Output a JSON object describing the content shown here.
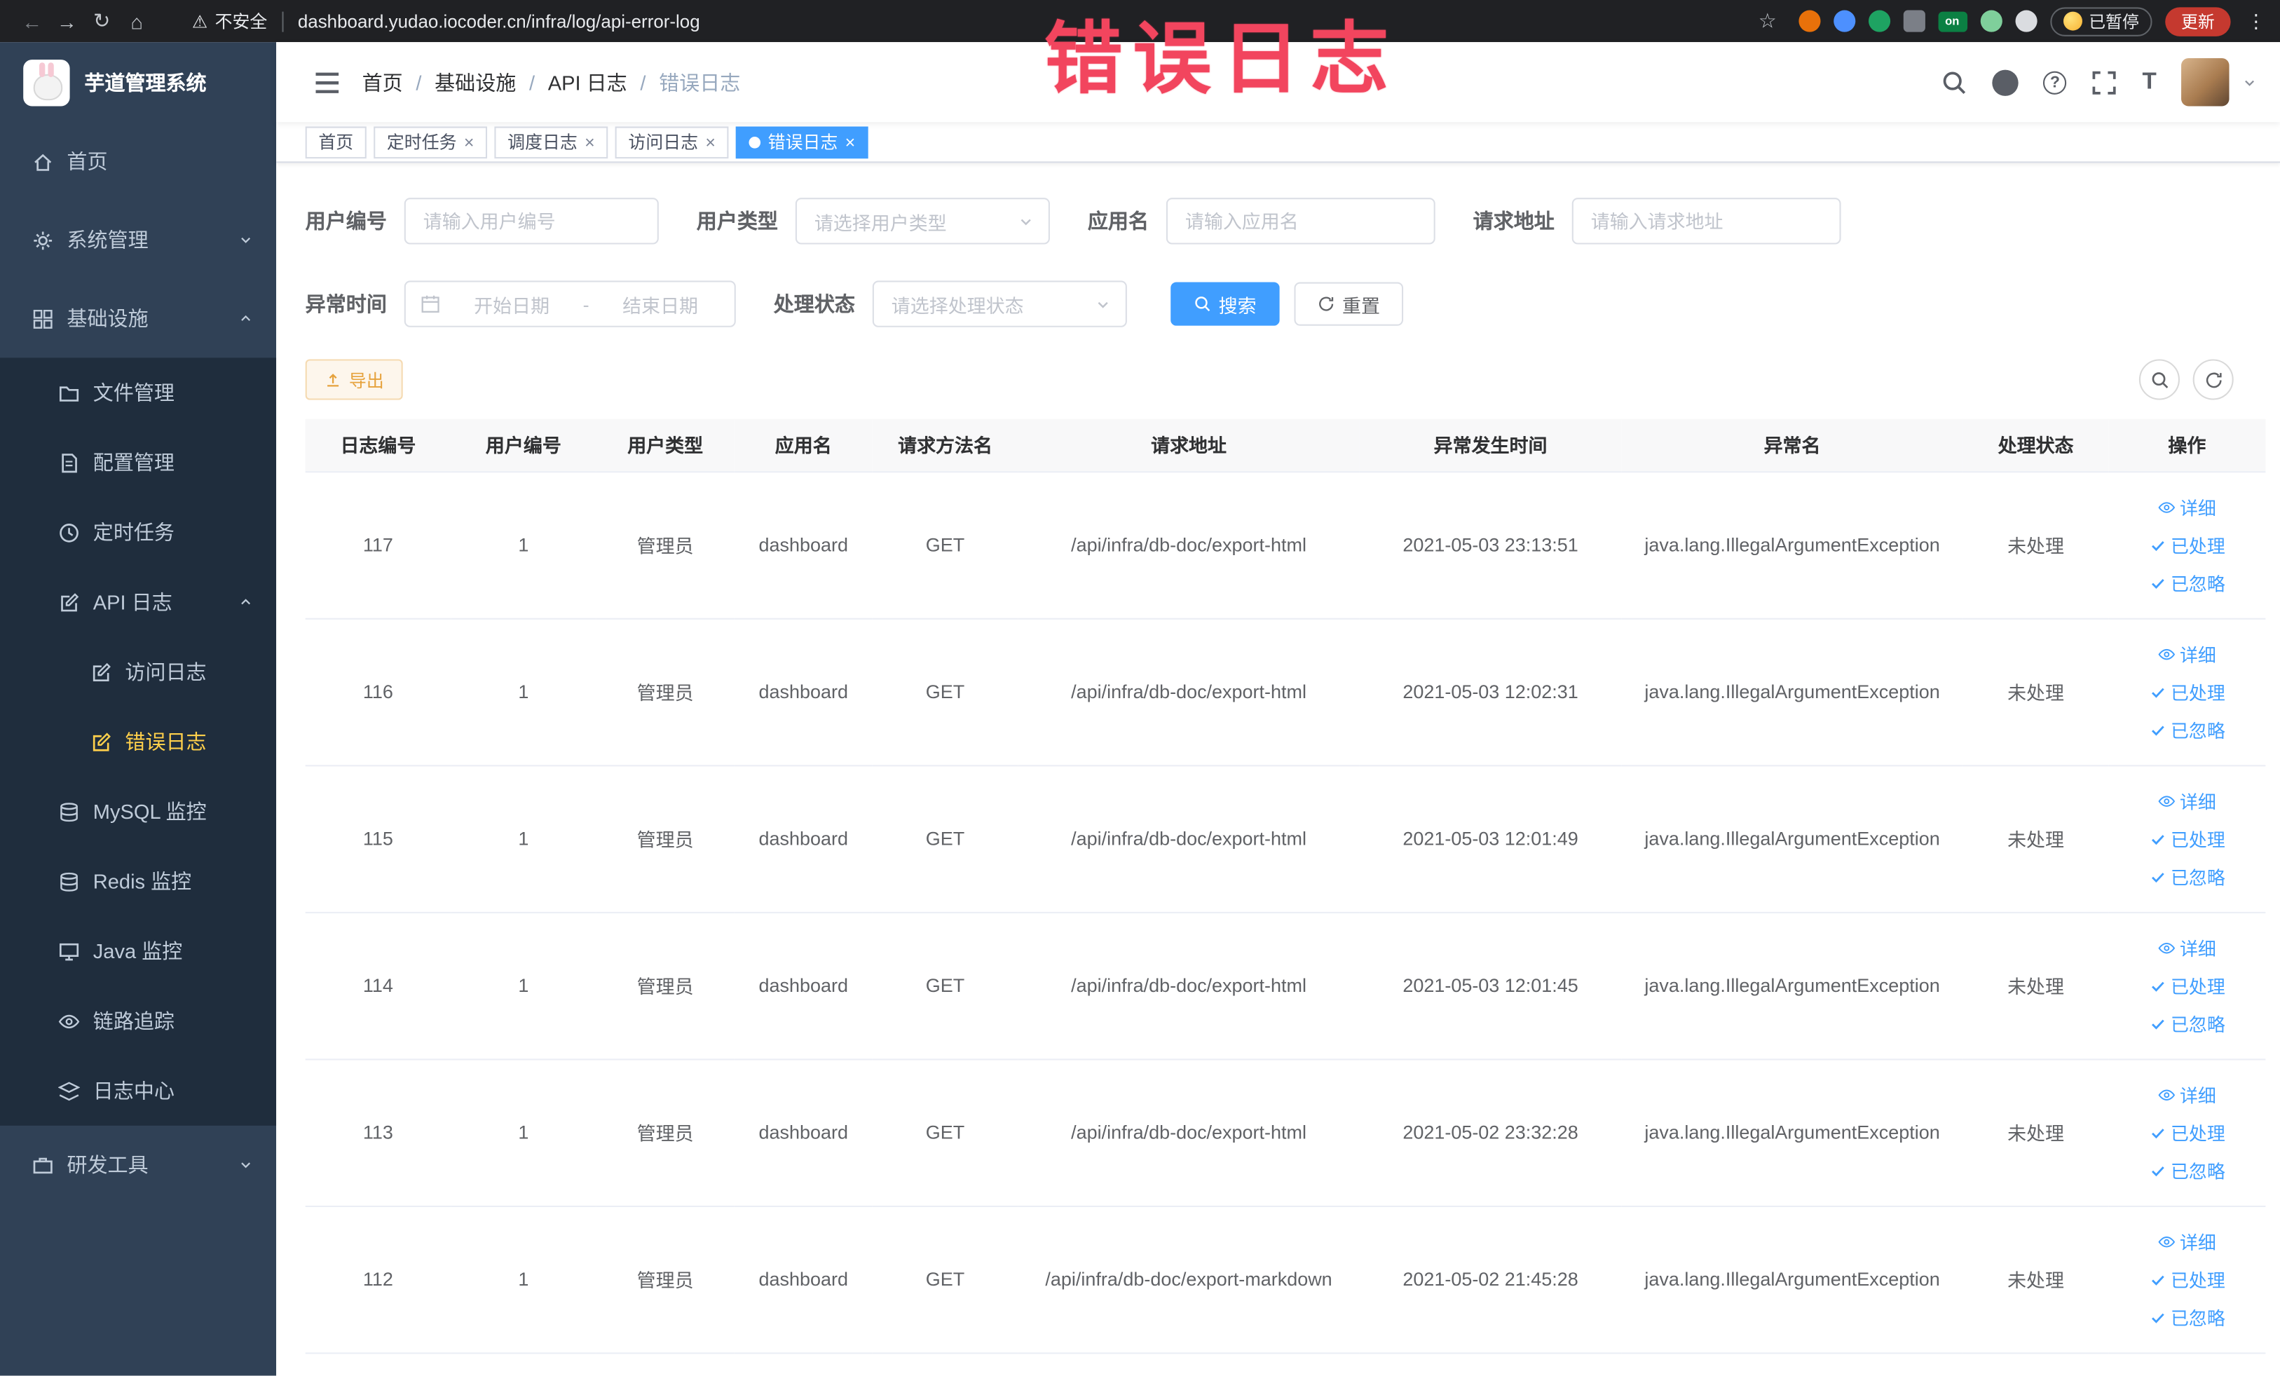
{
  "browser": {
    "security_label": "不安全",
    "url": "dashboard.yudao.iocoder.cn/infra/log/api-error-log",
    "extension_on_badge": "on",
    "paused_button": "已暂停",
    "update_button": "更新"
  },
  "icons": {
    "back": "←",
    "forward": "→",
    "reload": "↻",
    "home": "⌂",
    "star": "☆",
    "warning": "⚠",
    "kebab": "⋮",
    "close": "×",
    "question": "?",
    "font_size": "T"
  },
  "watermark": "错误日志",
  "sidebar": {
    "logo_title": "芋道管理系统",
    "home": "首页",
    "system_mgmt": "系统管理",
    "infrastructure": "基础设施",
    "file_mgmt": "文件管理",
    "config_mgmt": "配置管理",
    "scheduled_tasks": "定时任务",
    "api_log": "API 日志",
    "access_log": "访问日志",
    "error_log": "错误日志",
    "mysql_monitor": "MySQL 监控",
    "redis_monitor": "Redis 监控",
    "java_monitor": "Java 监控",
    "trace": "链路追踪",
    "log_center": "日志中心",
    "dev_tools": "研发工具"
  },
  "breadcrumb": {
    "separator": "/",
    "items": [
      "首页",
      "基础设施",
      "API 日志",
      "错误日志"
    ]
  },
  "tabs": [
    "首页",
    "定时任务",
    "调度日志",
    "访问日志",
    "错误日志"
  ],
  "filters": {
    "user_id_label": "用户编号",
    "user_id_placeholder": "请输入用户编号",
    "user_type_label": "用户类型",
    "user_type_placeholder": "请选择用户类型",
    "app_name_label": "应用名",
    "app_name_placeholder": "请输入应用名",
    "request_url_label": "请求地址",
    "request_url_placeholder": "请输入请求地址",
    "exception_time_label": "异常时间",
    "start_date_placeholder": "开始日期",
    "date_separator": "-",
    "end_date_placeholder": "结束日期",
    "process_status_label": "处理状态",
    "process_status_placeholder": "请选择处理状态",
    "search_button": "搜索",
    "reset_button": "重置"
  },
  "toolbar": {
    "export_button": "导出"
  },
  "table": {
    "columns": [
      "日志编号",
      "用户编号",
      "用户类型",
      "应用名",
      "请求方法名",
      "请求地址",
      "异常发生时间",
      "异常名",
      "处理状态",
      "操作"
    ],
    "action_labels": {
      "detail": "详细",
      "processed": "已处理",
      "ignored": "已忽略"
    },
    "rows": [
      {
        "id": "117",
        "user_id": "1",
        "user_type": "管理员",
        "app_name": "dashboard",
        "method": "GET",
        "url": "/api/infra/db-doc/export-html",
        "time": "2021-05-03 23:13:51",
        "exception": "java.lang.IllegalArgumentException",
        "status": "未处理"
      },
      {
        "id": "116",
        "user_id": "1",
        "user_type": "管理员",
        "app_name": "dashboard",
        "method": "GET",
        "url": "/api/infra/db-doc/export-html",
        "time": "2021-05-03 12:02:31",
        "exception": "java.lang.IllegalArgumentException",
        "status": "未处理"
      },
      {
        "id": "115",
        "user_id": "1",
        "user_type": "管理员",
        "app_name": "dashboard",
        "method": "GET",
        "url": "/api/infra/db-doc/export-html",
        "time": "2021-05-03 12:01:49",
        "exception": "java.lang.IllegalArgumentException",
        "status": "未处理"
      },
      {
        "id": "114",
        "user_id": "1",
        "user_type": "管理员",
        "app_name": "dashboard",
        "method": "GET",
        "url": "/api/infra/db-doc/export-html",
        "time": "2021-05-03 12:01:45",
        "exception": "java.lang.IllegalArgumentException",
        "status": "未处理"
      },
      {
        "id": "113",
        "user_id": "1",
        "user_type": "管理员",
        "app_name": "dashboard",
        "method": "GET",
        "url": "/api/infra/db-doc/export-html",
        "time": "2021-05-02 23:32:28",
        "exception": "java.lang.IllegalArgumentException",
        "status": "未处理"
      },
      {
        "id": "112",
        "user_id": "1",
        "user_type": "管理员",
        "app_name": "dashboard",
        "method": "GET",
        "url": "/api/infra/db-doc/export-markdown",
        "time": "2021-05-02 21:45:28",
        "exception": "java.lang.IllegalArgumentException",
        "status": "未处理"
      }
    ]
  }
}
